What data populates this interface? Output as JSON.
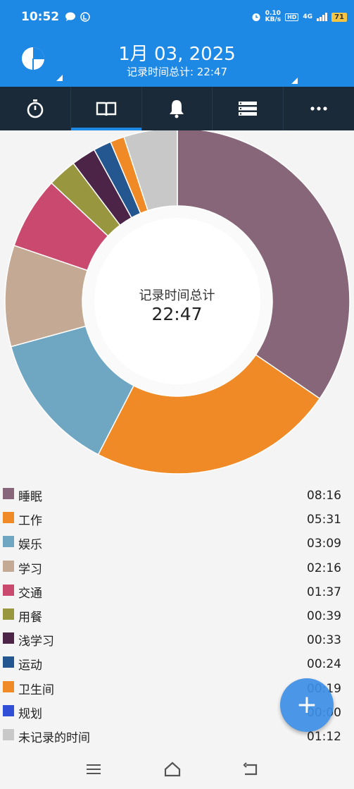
{
  "status_bar": {
    "time": "10:52",
    "net_speed_value": "0.10",
    "net_speed_unit": "KB/s",
    "hd": "HD",
    "network": "4G",
    "battery": "71"
  },
  "header": {
    "date": "1月 03, 2025",
    "total_label": "记录时间总计: 22:47"
  },
  "tabs": [
    {
      "icon": "stopwatch-icon",
      "active": false
    },
    {
      "icon": "book-icon",
      "active": true
    },
    {
      "icon": "bell-icon",
      "active": false
    },
    {
      "icon": "list-icon",
      "active": false
    },
    {
      "icon": "more-icon",
      "active": false
    }
  ],
  "chart_data": {
    "type": "pie",
    "center_label": "记录时间总计",
    "center_value": "22:47",
    "categories": [
      "睡眠",
      "工作",
      "娱乐",
      "学习",
      "交通",
      "用餐",
      "浅学习",
      "运动",
      "卫生间",
      "规划",
      "未记录的时间"
    ],
    "values": [
      "08:16",
      "05:31",
      "03:09",
      "02:16",
      "01:37",
      "00:39",
      "00:33",
      "00:24",
      "00:19",
      "00:00",
      "01:12"
    ],
    "minutes": [
      496,
      331,
      189,
      136,
      97,
      39,
      33,
      24,
      19,
      0,
      72
    ],
    "colors": [
      "#866678",
      "#ef8a26",
      "#6fa7c2",
      "#c4aa94",
      "#c94a6e",
      "#98973f",
      "#4c2447",
      "#24568f",
      "#ef8a26",
      "#2f4fd6",
      "#c8c8c8"
    ]
  },
  "legend": [
    {
      "name": "睡眠",
      "time": "08:16",
      "color": "#866678"
    },
    {
      "name": "工作",
      "time": "05:31",
      "color": "#ef8a26"
    },
    {
      "name": "娱乐",
      "time": "03:09",
      "color": "#6fa7c2"
    },
    {
      "name": "学习",
      "time": "02:16",
      "color": "#c4aa94"
    },
    {
      "name": "交通",
      "time": "01:37",
      "color": "#c94a6e"
    },
    {
      "name": "用餐",
      "time": "00:39",
      "color": "#98973f"
    },
    {
      "name": "浅学习",
      "time": "00:33",
      "color": "#4c2447"
    },
    {
      "name": "运动",
      "time": "00:24",
      "color": "#24568f"
    },
    {
      "name": "卫生间",
      "time": "00:19",
      "color": "#ef8a26"
    },
    {
      "name": "规划",
      "time": "00:00",
      "color": "#2f4fd6"
    },
    {
      "name": "未记录的时间",
      "time": "01:12",
      "color": "#c8c8c8"
    }
  ],
  "fab": {
    "symbol": "+"
  },
  "colors": {
    "primary": "#1e88e5",
    "tab_bar": "#1b2a38"
  }
}
